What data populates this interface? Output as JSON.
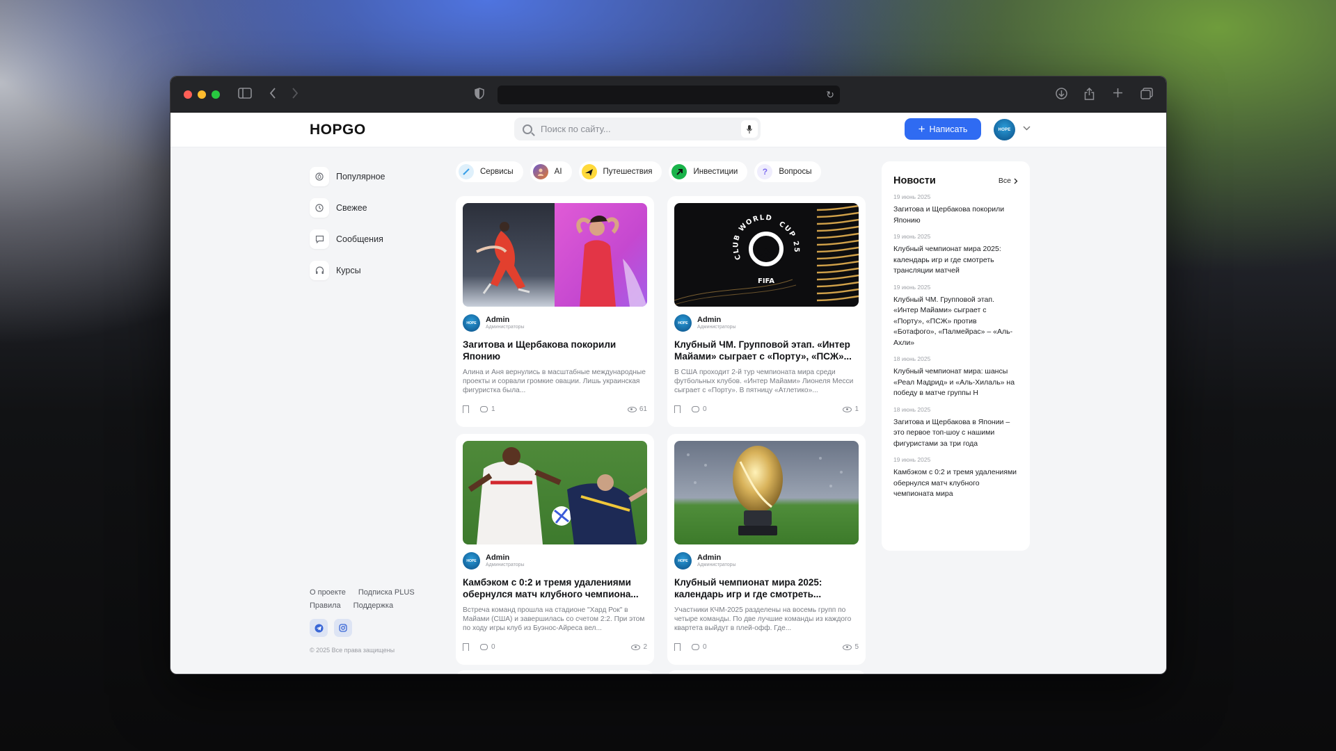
{
  "site": {
    "logo": "HOPGO",
    "search_placeholder": "Поиск по сайту...",
    "write_label": "Написать",
    "avatar_text": "HOPE"
  },
  "nav": [
    {
      "label": "Популярное",
      "icon": "fire-icon"
    },
    {
      "label": "Свежее",
      "icon": "clock-icon"
    },
    {
      "label": "Сообщения",
      "icon": "message-icon"
    },
    {
      "label": "Курсы",
      "icon": "headphones-icon"
    }
  ],
  "footer": {
    "links_row1": [
      "О проекте",
      "Подписка PLUS"
    ],
    "links_row2": [
      "Правила",
      "Поддержка"
    ],
    "copyright": "© 2025 Все права защищены"
  },
  "chips": [
    {
      "label": "Сервисы",
      "color": "#3aa0e8"
    },
    {
      "label": "AI",
      "color": "#d66a2c"
    },
    {
      "label": "Путешествия",
      "color": "#1a1a1a"
    },
    {
      "label": "Инвестиции",
      "color": "#19b34a"
    },
    {
      "label": "Вопросы",
      "color": "#9a8cf0"
    }
  ],
  "cards": [
    {
      "author": "Admin",
      "role": "Администраторы",
      "title": "Загитова и Щербакова покорили Японию",
      "desc": "Алина и Аня вернулись в масштабные международные проекты и сорвали громкие овации. Лишь украинская фигуристка была...",
      "comments": "1",
      "views": "61"
    },
    {
      "author": "Admin",
      "role": "Администраторы",
      "title": "Клубный ЧМ. Групповой этап. «Интер Майами» сыграет с «Порту», «ПСЖ»...",
      "desc": "В США проходит 2-й тур чемпионата мира среди футбольных клубов. «Интер Майами» Лионеля Месси сыграет с «Порту». В пятницу «Атлетико»...",
      "comments": "0",
      "views": "1",
      "image_text": {
        "arc_left": "CLUB WORLD",
        "arc_right": "CUP 25",
        "brand": "FIFA"
      }
    },
    {
      "author": "Admin",
      "role": "Администраторы",
      "title": "Камбэком с 0:2 и тремя удалениями обернулся матч клубного чемпиона...",
      "desc": "Встреча команд прошла на стадионе \"Хард Рок\" в Майами (США) и завершилась со счетом 2:2. При этом по ходу игры клуб из Буэнос-Айреса вел...",
      "comments": "0",
      "views": "2"
    },
    {
      "author": "Admin",
      "role": "Администраторы",
      "title": "Клубный чемпионат мира 2025: календарь игр и где смотреть...",
      "desc": "Участники КЧМ-2025 разделены на восемь групп по четыре команды. По две лучшие команды из каждого квартета выйдут в плей-офф. Где...",
      "comments": "0",
      "views": "5"
    }
  ],
  "news": {
    "title": "Новости",
    "all_label": "Все",
    "items": [
      {
        "date": "19 июнь 2025",
        "text": "Загитова и Щербакова покорили Японию"
      },
      {
        "date": "19 июнь 2025",
        "text": "Клубный чемпионат мира 2025: календарь игр и где смотреть трансляции матчей"
      },
      {
        "date": "19 июнь 2025",
        "text": "Клубный ЧМ. Групповой этап. «Интер Майами» сыграет с «Порту», «ПСЖ» против «Ботафого», «Палмейрас» – «Аль-Ахли»"
      },
      {
        "date": "18 июнь 2025",
        "text": "Клубный чемпионат мира: шансы «Реал Мадрид» и «Аль-Хилаль» на победу в матче группы H"
      },
      {
        "date": "18 июнь 2025",
        "text": "Загитова и Щербакова в Японии – это первое топ-шоу с нашими фигуристами за три года"
      },
      {
        "date": "19 июнь 2025",
        "text": "Камбэком с 0:2 и тремя удалениями обернулся матч клубного чемпионата мира"
      }
    ]
  },
  "colors": {
    "accent": "#2f6bf2",
    "traffic_red": "#fe5f57",
    "traffic_yellow": "#febc2e",
    "traffic_green": "#28c840"
  }
}
